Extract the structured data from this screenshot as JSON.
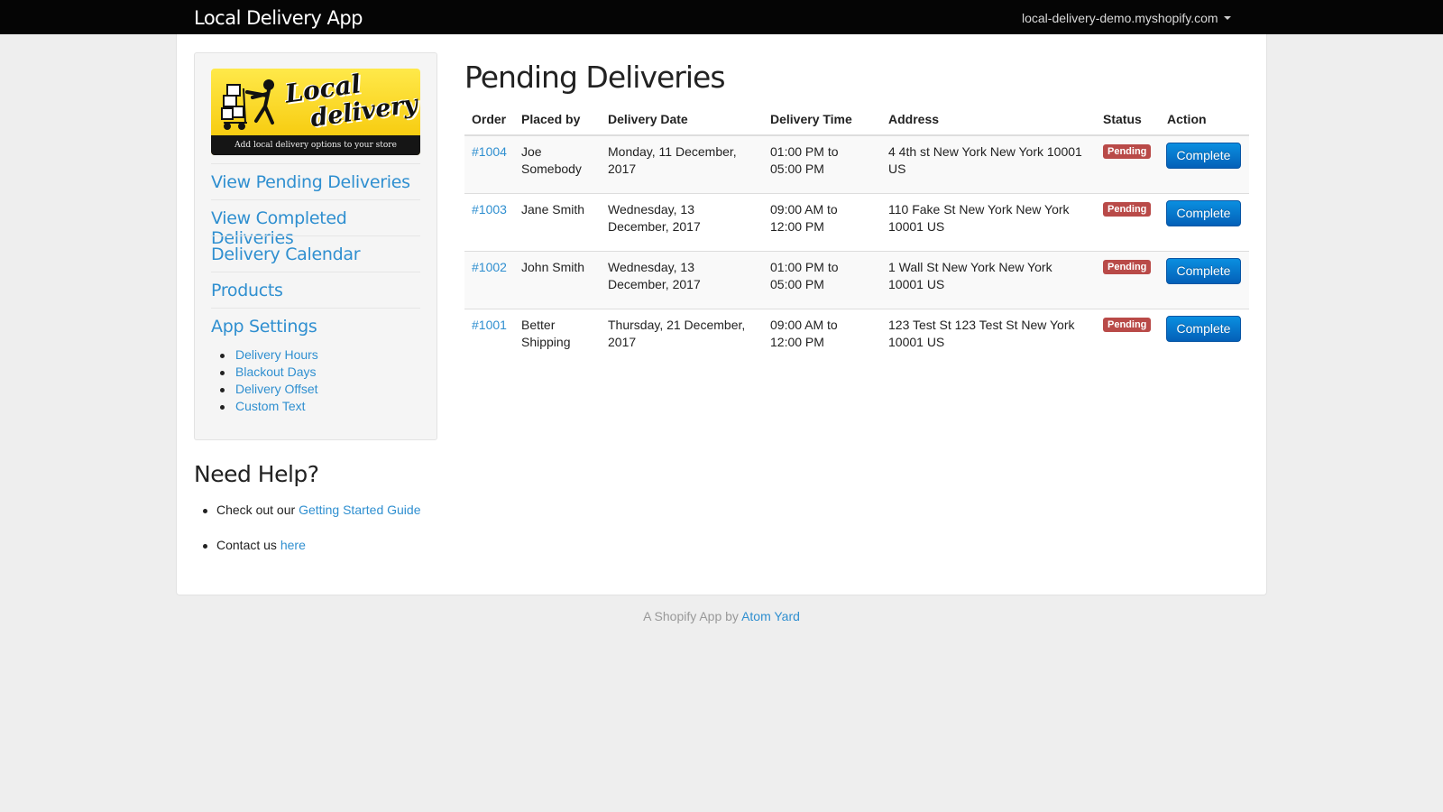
{
  "app": {
    "title": "Local Delivery App",
    "shop": "local-delivery-demo.myshopify.com"
  },
  "logo": {
    "line1": "Local",
    "line2": "delivery",
    "tagline": "Add local delivery options to your store"
  },
  "sidebar": {
    "items": [
      {
        "label": "View Pending Deliveries"
      },
      {
        "label": "View Completed Deliveries"
      },
      {
        "label": "Delivery Calendar"
      },
      {
        "label": "Products"
      },
      {
        "label": "App Settings"
      }
    ],
    "sub_items": [
      "Delivery Hours",
      "Blackout Days",
      "Delivery Offset",
      "Custom Text"
    ]
  },
  "help": {
    "title": "Need Help?",
    "guide_prefix": "Check out our ",
    "guide_link": "Getting Started Guide",
    "contact_prefix": "Contact us ",
    "contact_link": "here"
  },
  "main": {
    "title": "Pending Deliveries",
    "columns": [
      "Order",
      "Placed by",
      "Delivery Date",
      "Delivery Time",
      "Address",
      "Status",
      "Action"
    ],
    "rows": [
      {
        "order": "#1004",
        "placed_by_1": "Joe",
        "placed_by_2": "Somebody",
        "date_1": "Monday, 11 December,",
        "date_2": "2017",
        "time_1": "01:00 PM to",
        "time_2": "05:00 PM",
        "addr_1": "4 4th st New York New York 10001",
        "addr_2": "US",
        "status": "Pending",
        "action": "Complete"
      },
      {
        "order": "#1003",
        "placed_by_1": "Jane Smith",
        "placed_by_2": "",
        "date_1": "Wednesday, 13",
        "date_2": "December, 2017",
        "time_1": "09:00 AM to",
        "time_2": "12:00 PM",
        "addr_1": "110 Fake St New York New York",
        "addr_2": "10001 US",
        "status": "Pending",
        "action": "Complete"
      },
      {
        "order": "#1002",
        "placed_by_1": "John Smith",
        "placed_by_2": "",
        "date_1": "Wednesday, 13",
        "date_2": "December, 2017",
        "time_1": "01:00 PM to",
        "time_2": "05:00 PM",
        "addr_1": "1 Wall St New York New York",
        "addr_2": "10001 US",
        "status": "Pending",
        "action": "Complete"
      },
      {
        "order": "#1001",
        "placed_by_1": "Better",
        "placed_by_2": "Shipping",
        "date_1": "Thursday, 21 December,",
        "date_2": "2017",
        "time_1": "09:00 AM to",
        "time_2": "12:00 PM",
        "addr_1": "123 Test St 123 Test St New York",
        "addr_2": "10001 US",
        "status": "Pending",
        "action": "Complete"
      }
    ]
  },
  "footer": {
    "prefix": "A Shopify App by ",
    "link": "Atom Yard"
  },
  "colors": {
    "link": "#2f8fd0",
    "badge": "#b94a48",
    "button": "#0a7fd6",
    "topbar": "#050505"
  }
}
